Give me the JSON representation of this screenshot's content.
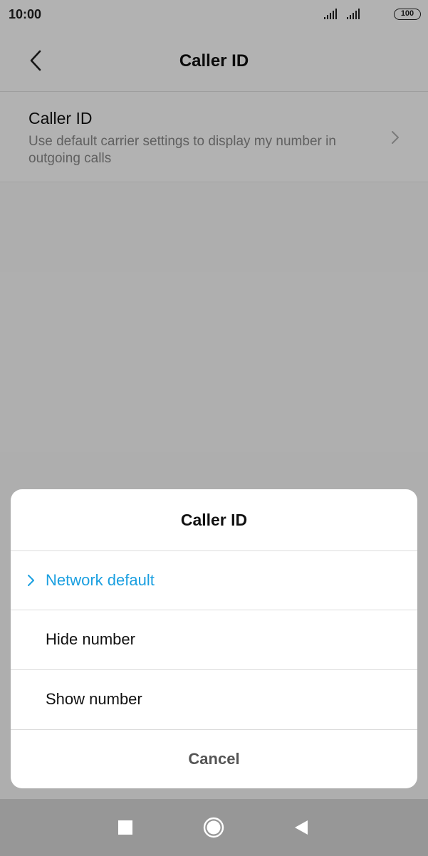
{
  "status_bar": {
    "time": "10:00",
    "battery": "100",
    "icons": [
      "signal-icon",
      "signal-icon",
      "battery-icon"
    ]
  },
  "app_bar": {
    "back_icon": "back-arrow-icon",
    "title": "Caller ID"
  },
  "setting": {
    "title": "Caller ID",
    "description": "Use default carrier settings to display my number in outgoing calls",
    "chevron_icon": "chevron-right-icon"
  },
  "dialog": {
    "title": "Caller ID",
    "options": [
      {
        "label": "Network default",
        "selected": true
      },
      {
        "label": "Hide number",
        "selected": false
      },
      {
        "label": "Show number",
        "selected": false
      }
    ],
    "cancel_label": "Cancel",
    "accent_color": "#1a9fe0"
  },
  "nav_bar": {
    "buttons": [
      "recents-icon",
      "home-icon",
      "back-icon"
    ]
  }
}
